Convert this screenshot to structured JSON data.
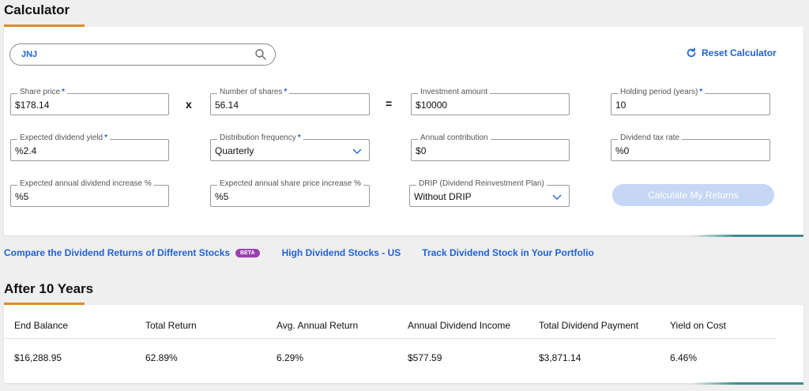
{
  "calculator": {
    "title": "Calculator",
    "search_value": "JNJ",
    "reset_label": "Reset Calculator",
    "fields": {
      "share_price": {
        "label": "Share price",
        "value": "178.14",
        "prefix": "$"
      },
      "number_of_shares": {
        "label": "Number of shares",
        "value": "56.14"
      },
      "investment_amount": {
        "label": "Investment amount",
        "value": "10000",
        "prefix": "$"
      },
      "holding_period": {
        "label": "Holding period (years)",
        "value": "10"
      },
      "expected_dividend_yield": {
        "label": "Expected dividend yield",
        "value": "2.4",
        "prefix": "%"
      },
      "distribution_frequency": {
        "label": "Distribution frequency",
        "value": "Quarterly"
      },
      "annual_contribution": {
        "label": "Annual contribution",
        "value": "0",
        "prefix": "$"
      },
      "dividend_tax_rate": {
        "label": "Dividend tax rate",
        "value": "0",
        "prefix": "%"
      },
      "expected_annual_dividend_increase": {
        "label": "Expected annual dividend increase %",
        "value": "5",
        "prefix": "%"
      },
      "expected_annual_share_price_increase": {
        "label": "Expected annual share price increase %",
        "value": "5",
        "prefix": "%"
      },
      "drip": {
        "label": "DRIP (Dividend Reinvestment Plan)",
        "value": "Without DRIP"
      }
    },
    "operators": {
      "times": "x",
      "equals": "="
    },
    "calculate_label": "Calculate My Returns"
  },
  "links": {
    "compare": "Compare the Dividend Returns of Different Stocks",
    "beta": "BETA",
    "high_dividend": "High Dividend Stocks - US",
    "track": "Track Dividend Stock in Your Portfolio"
  },
  "results": {
    "title": "After 10 Years",
    "headers": [
      "End Balance",
      "Total Return",
      "Avg. Annual Return",
      "Annual Dividend Income",
      "Total Dividend Payment",
      "Yield on Cost"
    ],
    "values": [
      "$16,288.95",
      "62.89%",
      "6.29%",
      "$577.59",
      "$3,871.14",
      "6.46%"
    ]
  },
  "colors": {
    "accent_blue": "#1f63d6",
    "accent_orange": "#e08a2b",
    "teal": "#3e8e8c",
    "beta_purple": "#9b3fb0",
    "button_disabled": "#c6d7f5"
  },
  "icons": [
    "search-icon",
    "refresh-icon",
    "chevron-down-icon"
  ]
}
